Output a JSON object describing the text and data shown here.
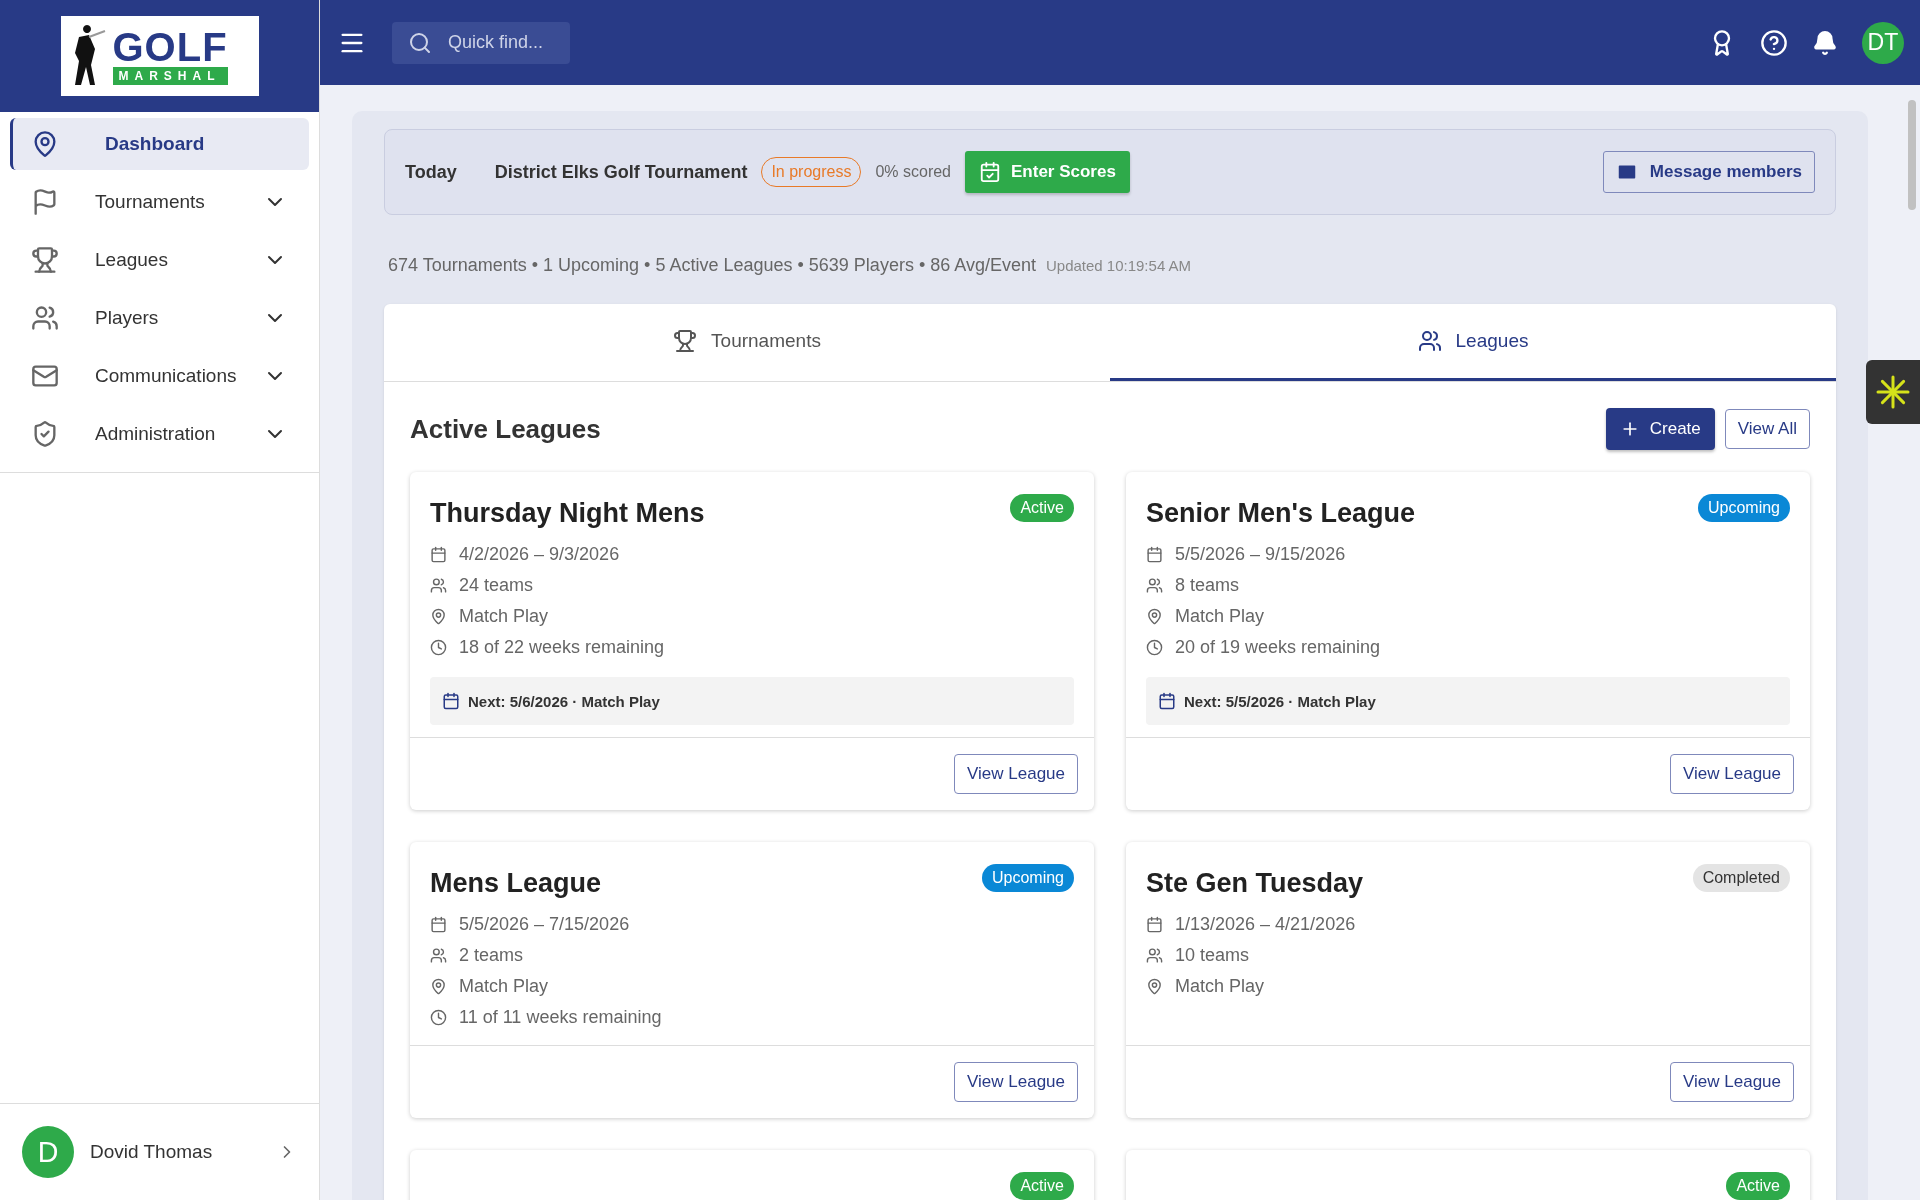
{
  "sidebar": {
    "items": [
      {
        "label": "Dashboard",
        "selected": true,
        "expandable": false
      },
      {
        "label": "Tournaments",
        "selected": false,
        "expandable": true
      },
      {
        "label": "Leagues",
        "selected": false,
        "expandable": true
      },
      {
        "label": "Players",
        "selected": false,
        "expandable": true
      },
      {
        "label": "Communications",
        "selected": false,
        "expandable": true
      },
      {
        "label": "Administration",
        "selected": false,
        "expandable": true
      }
    ],
    "user": {
      "initial": "D",
      "name": "Dovid Thomas"
    }
  },
  "logo": {
    "title": "GOLF",
    "subtitle": "MARSHAL"
  },
  "topbar": {
    "search_placeholder": "Quick find...",
    "avatar": "DT"
  },
  "today": {
    "label": "Today",
    "event": "District Elks Golf Tournament",
    "status": "In progress",
    "scored": "0% scored",
    "enter_button": "Enter Scores",
    "message_button": "Message members"
  },
  "stats": {
    "summary": "674 Tournaments • 1 Upcoming • 5 Active Leagues • 5639 Players • 86 Avg/Event",
    "updated": "Updated 10:19:54 AM"
  },
  "tabs": [
    {
      "label": "Tournaments",
      "selected": false
    },
    {
      "label": "Leagues",
      "selected": true
    }
  ],
  "section": {
    "title": "Active Leagues",
    "create_button": "Create",
    "view_all_button": "View All"
  },
  "leagues": [
    {
      "name": "Thursday Night Mens",
      "status": "Active",
      "color": "#2eaa4a",
      "dates": "4/2/2026 – 9/3/2026",
      "teams": "24 teams",
      "format": "Match Play",
      "remaining": "18 of 22 weeks remaining",
      "next": "Next: 5/6/2026 · Match Play",
      "button": "View League"
    },
    {
      "name": "Senior Men's League",
      "status": "Upcoming",
      "color": "#0a88d6",
      "dates": "5/5/2026 – 9/15/2026",
      "teams": "8 teams",
      "format": "Match Play",
      "remaining": "20 of 19 weeks remaining",
      "next": "Next: 5/5/2026 · Match Play",
      "button": "View League"
    },
    {
      "name": "Mens League",
      "status": "Upcoming",
      "color": "#0a88d6",
      "dates": "5/5/2026 – 7/15/2026",
      "teams": "2 teams",
      "format": "Match Play",
      "remaining": "11 of 11 weeks remaining",
      "button": "View League"
    },
    {
      "name": "Ste Gen Tuesday",
      "status": "Completed",
      "color": "#e4e4e4",
      "dates": "1/13/2026 – 4/21/2026",
      "teams": "10 teams",
      "format": "Match Play",
      "button": "View League"
    },
    {
      "status": "Active",
      "color": "#2eaa4a"
    },
    {
      "status": "Active",
      "color": "#2eaa4a"
    }
  ]
}
